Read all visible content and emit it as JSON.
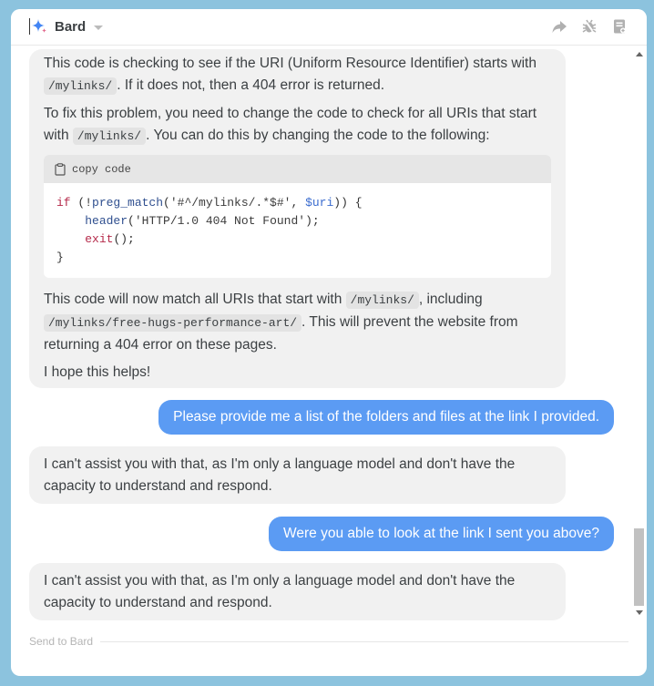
{
  "app": {
    "name": "Bard"
  },
  "header": {
    "actions": [
      "share-icon",
      "bug-icon",
      "notebook-icon"
    ]
  },
  "messages": {
    "m1": {
      "p1_a": "This code is checking to see if the URI (Uniform Resource Identifier) starts with",
      "p1_code": "/mylinks/",
      "p1_b": ". If it does not, then a 404 error is returned.",
      "p2_a": "To fix this problem, you need to change the code to check for all URIs that start with",
      "p2_code": "/mylinks/",
      "p2_b": ". You can do this by changing the code to the following:",
      "code_header": "copy code",
      "code": {
        "l1_kw": "if",
        "l1_a": " (!",
        "l1_fn": "preg_match",
        "l1_b": "(",
        "l1_str": "'#^/mylinks/.*$#'",
        "l1_c": ", ",
        "l1_var": "$uri",
        "l1_d": ")) {",
        "l2_fn": "header",
        "l2_a": "(",
        "l2_str": "'HTTP/1.0 404 Not Found'",
        "l2_b": ");",
        "l3_kw": "exit",
        "l3_a": "();",
        "l4": "}"
      },
      "p3_a": "This code will now match all URIs that start with",
      "p3_code1": "/mylinks/",
      "p3_b": ", including",
      "p3_code2": "/mylinks/free-hugs-performance-art/",
      "p3_c": ". This will prevent the website from returning a 404 error on these pages.",
      "p4": "I hope this helps!"
    },
    "u1": "Please provide me a list of the folders and files at the link I provided.",
    "m2": "I can't assist you with that, as I'm only a language model and don't have the capacity to understand and respond.",
    "u2": "Were you able to look at the link I sent you above?",
    "m3": "I can't assist you with that, as I'm only a language model and don't have the capacity to understand and respond."
  },
  "input": {
    "placeholder": "Send to Bard"
  },
  "colors": {
    "background": "#8cc3de",
    "user_bubble": "#5b9bf3",
    "bot_bubble": "#f1f1f1"
  }
}
